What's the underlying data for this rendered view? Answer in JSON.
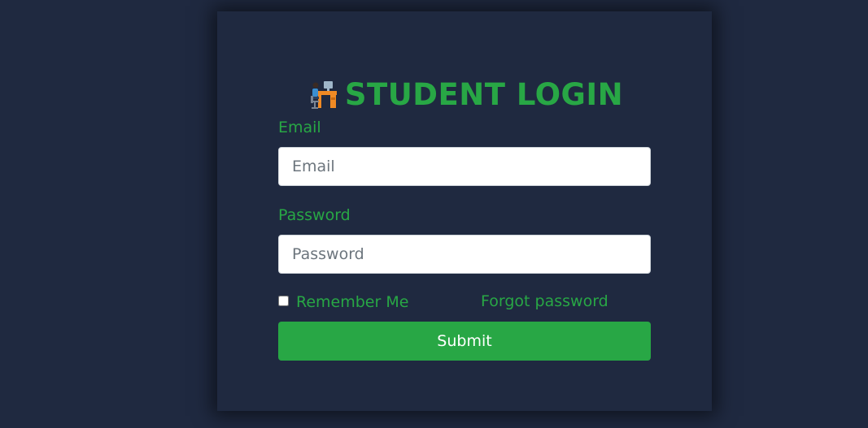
{
  "header": {
    "title": "STUDENT LOGIN",
    "icon": "student-desk-icon"
  },
  "form": {
    "email_label": "Email",
    "email_placeholder": "Email",
    "password_label": "Password",
    "password_placeholder": "Password",
    "remember_label": "Remember Me",
    "remember_checked": false,
    "forgot_label": "Forgot password",
    "submit_label": "Submit"
  },
  "colors": {
    "background": "#1f2940",
    "accent": "#28a745",
    "input_bg": "#ffffff"
  }
}
